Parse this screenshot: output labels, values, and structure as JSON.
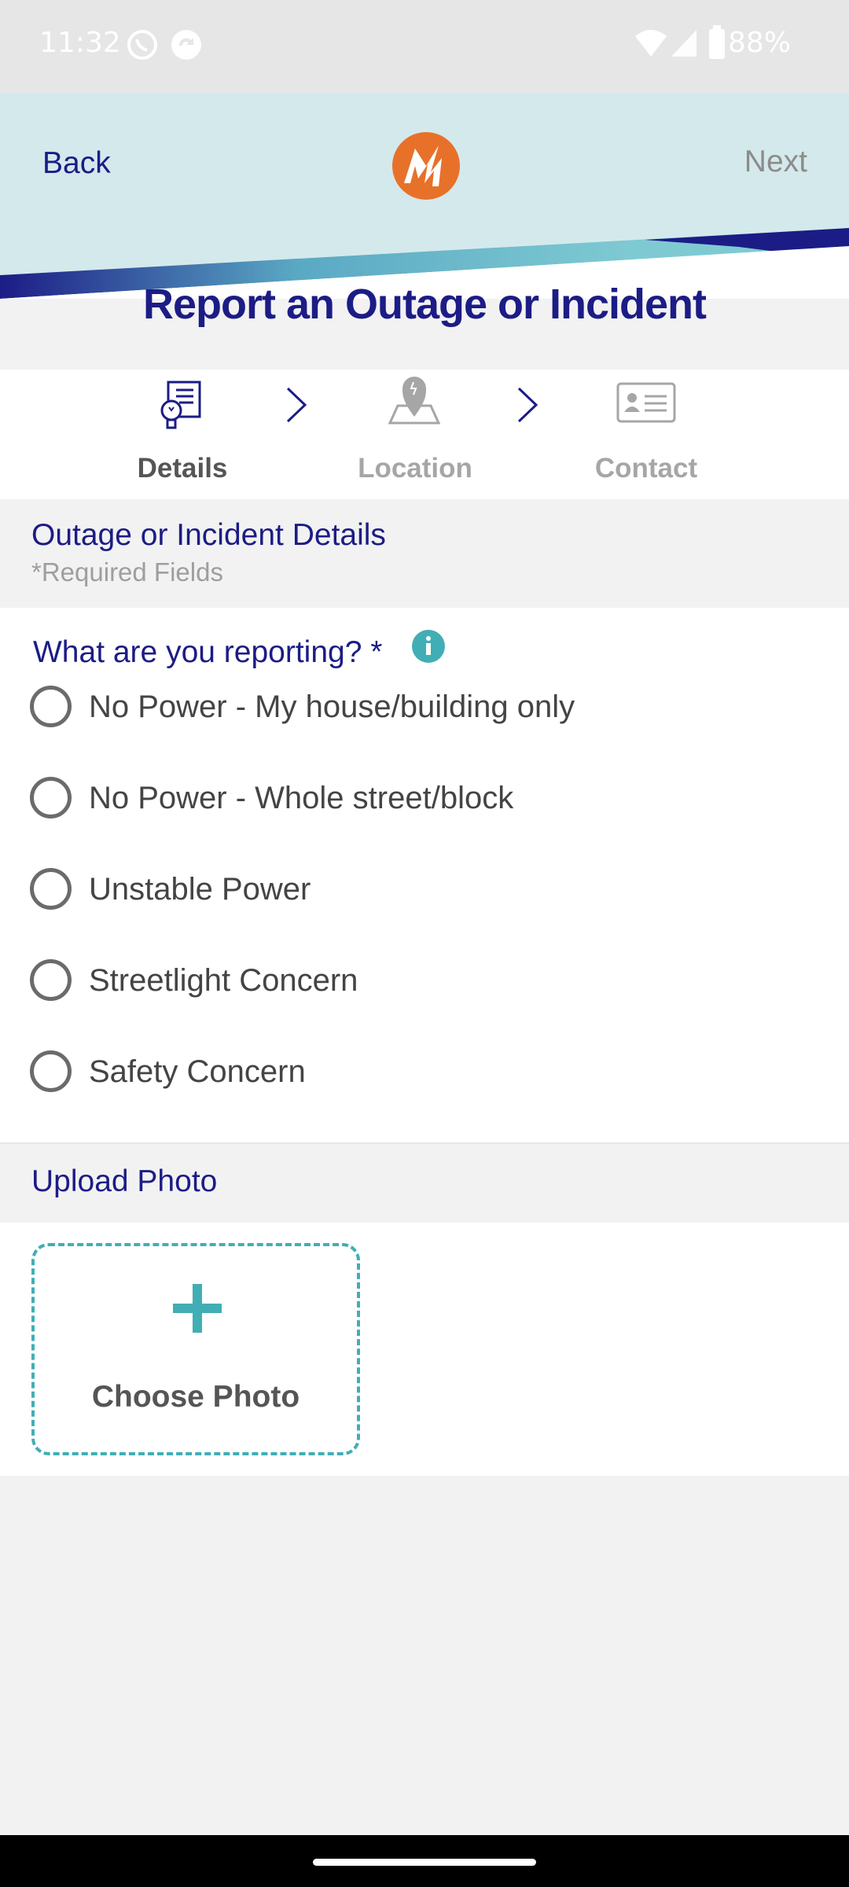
{
  "status_bar": {
    "time": "11:32",
    "battery": "88%",
    "icons": [
      "viber-icon",
      "sync-icon",
      "wifi-icon",
      "signal-icon",
      "battery-icon"
    ]
  },
  "header": {
    "back_label": "Back",
    "next_label": "Next",
    "logo": "lightning-m-logo",
    "colors": {
      "brand_orange": "#e8712a",
      "navy": "#1c1c86",
      "teal": "#41aeb5",
      "header_bg": "#d4e9ec"
    }
  },
  "page_title": "Report an Outage or Incident",
  "steps": [
    {
      "label": "Details",
      "icon": "document-lightbulb-icon",
      "active": true
    },
    {
      "label": "Location",
      "icon": "map-pin-icon",
      "active": false
    },
    {
      "label": "Contact",
      "icon": "contact-card-icon",
      "active": false
    }
  ],
  "details_section": {
    "title": "Outage or Incident Details",
    "required_note": "*Required Fields"
  },
  "reporting": {
    "question": "What are you reporting? *",
    "info_icon": "info-icon",
    "options": [
      {
        "label": "No Power - My house/building only",
        "selected": false
      },
      {
        "label": "No Power - Whole street/block",
        "selected": false
      },
      {
        "label": "Unstable Power",
        "selected": false
      },
      {
        "label": "Streetlight Concern",
        "selected": false
      },
      {
        "label": "Safety Concern",
        "selected": false
      }
    ]
  },
  "upload": {
    "title": "Upload Photo",
    "choose_label": "Choose Photo",
    "icon": "plus-icon"
  }
}
